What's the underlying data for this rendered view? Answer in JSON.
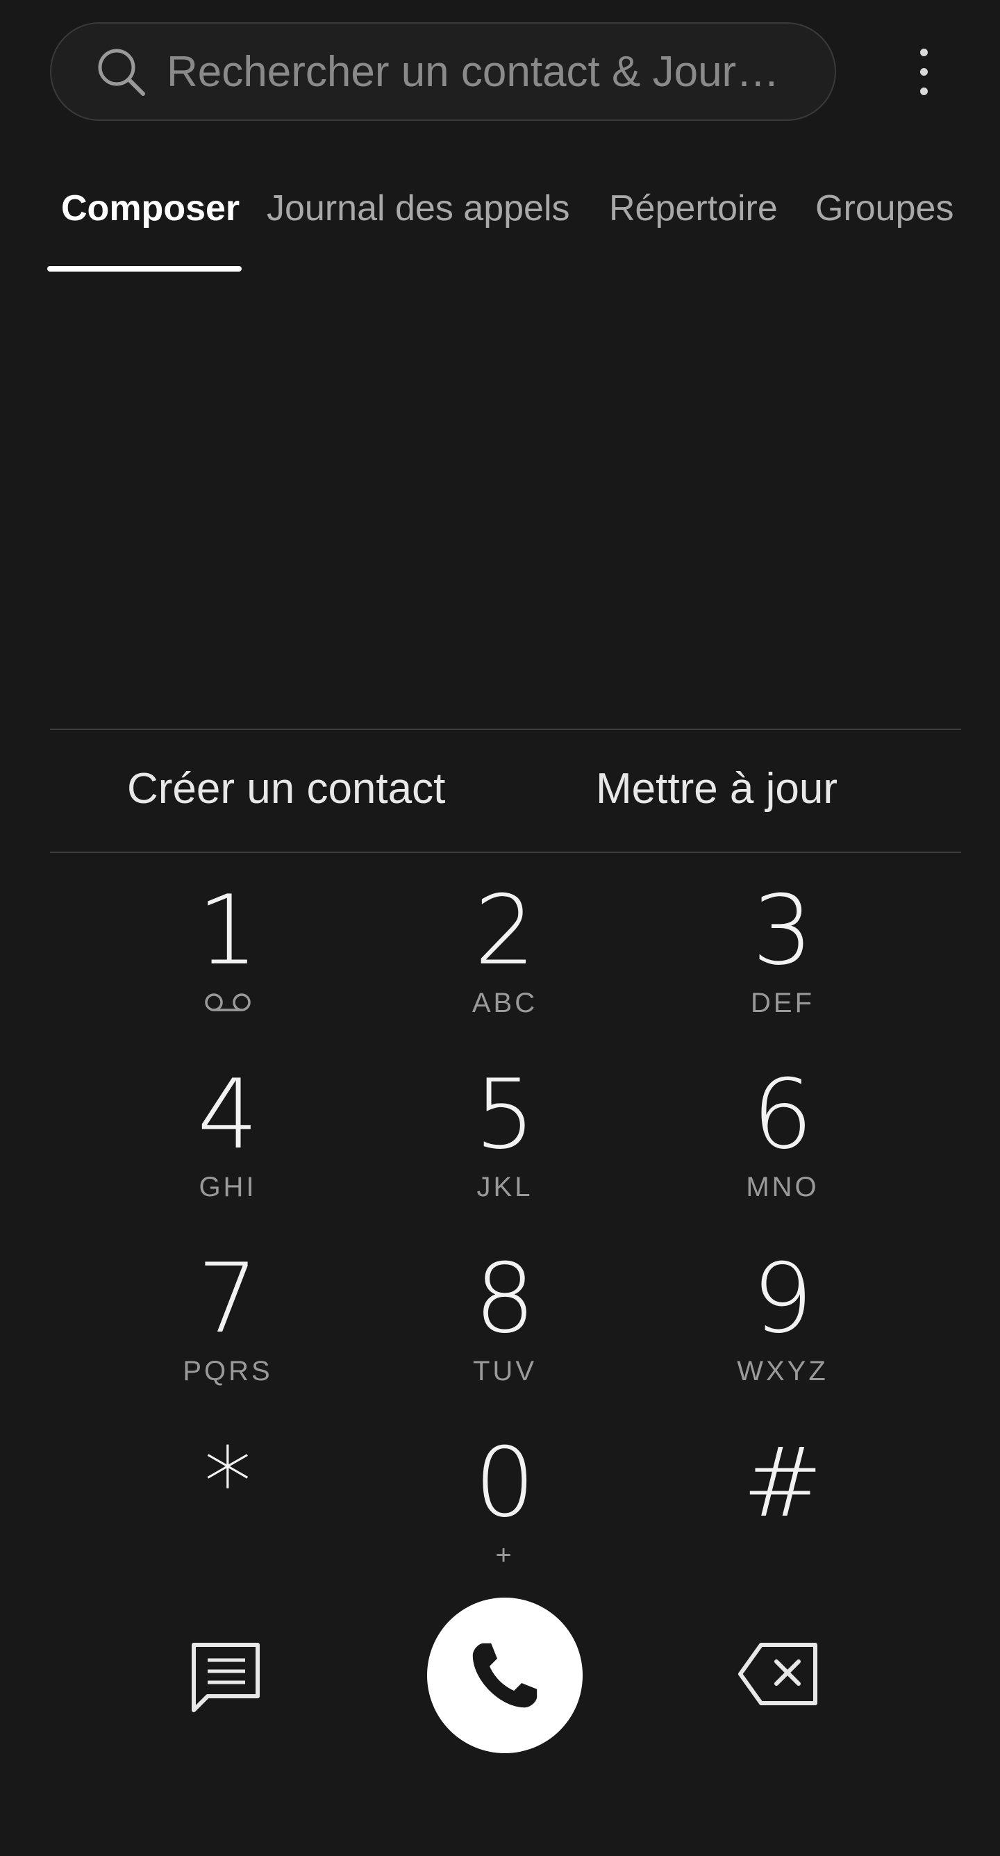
{
  "search": {
    "placeholder": "Rechercher un contact & Jour…",
    "icon": "search-icon"
  },
  "menu": {
    "icon": "more-vert-icon"
  },
  "tabs": [
    {
      "label": "Composer",
      "active": true
    },
    {
      "label": "Journal des appels",
      "active": false
    },
    {
      "label": "Répertoire",
      "active": false
    },
    {
      "label": "Groupes",
      "active": false
    }
  ],
  "actions": {
    "create_contact": "Créer un contact",
    "update": "Mettre à jour"
  },
  "keypad": [
    {
      "digit": "1",
      "letters": "",
      "icon": "voicemail-icon"
    },
    {
      "digit": "2",
      "letters": "ABC"
    },
    {
      "digit": "3",
      "letters": "DEF"
    },
    {
      "digit": "4",
      "letters": "GHI"
    },
    {
      "digit": "5",
      "letters": "JKL"
    },
    {
      "digit": "6",
      "letters": "MNO"
    },
    {
      "digit": "7",
      "letters": "PQRS"
    },
    {
      "digit": "8",
      "letters": "TUV"
    },
    {
      "digit": "9",
      "letters": "WXYZ"
    },
    {
      "digit": "*",
      "letters": ""
    },
    {
      "digit": "0",
      "letters": "+"
    },
    {
      "digit": "#",
      "letters": ""
    }
  ],
  "bottom": {
    "message_icon": "message-icon",
    "call_icon": "phone-icon",
    "backspace_icon": "backspace-icon"
  },
  "colors": {
    "background": "#181818",
    "accent": "#ffffff",
    "secondary_text": "#9a9a9a"
  }
}
